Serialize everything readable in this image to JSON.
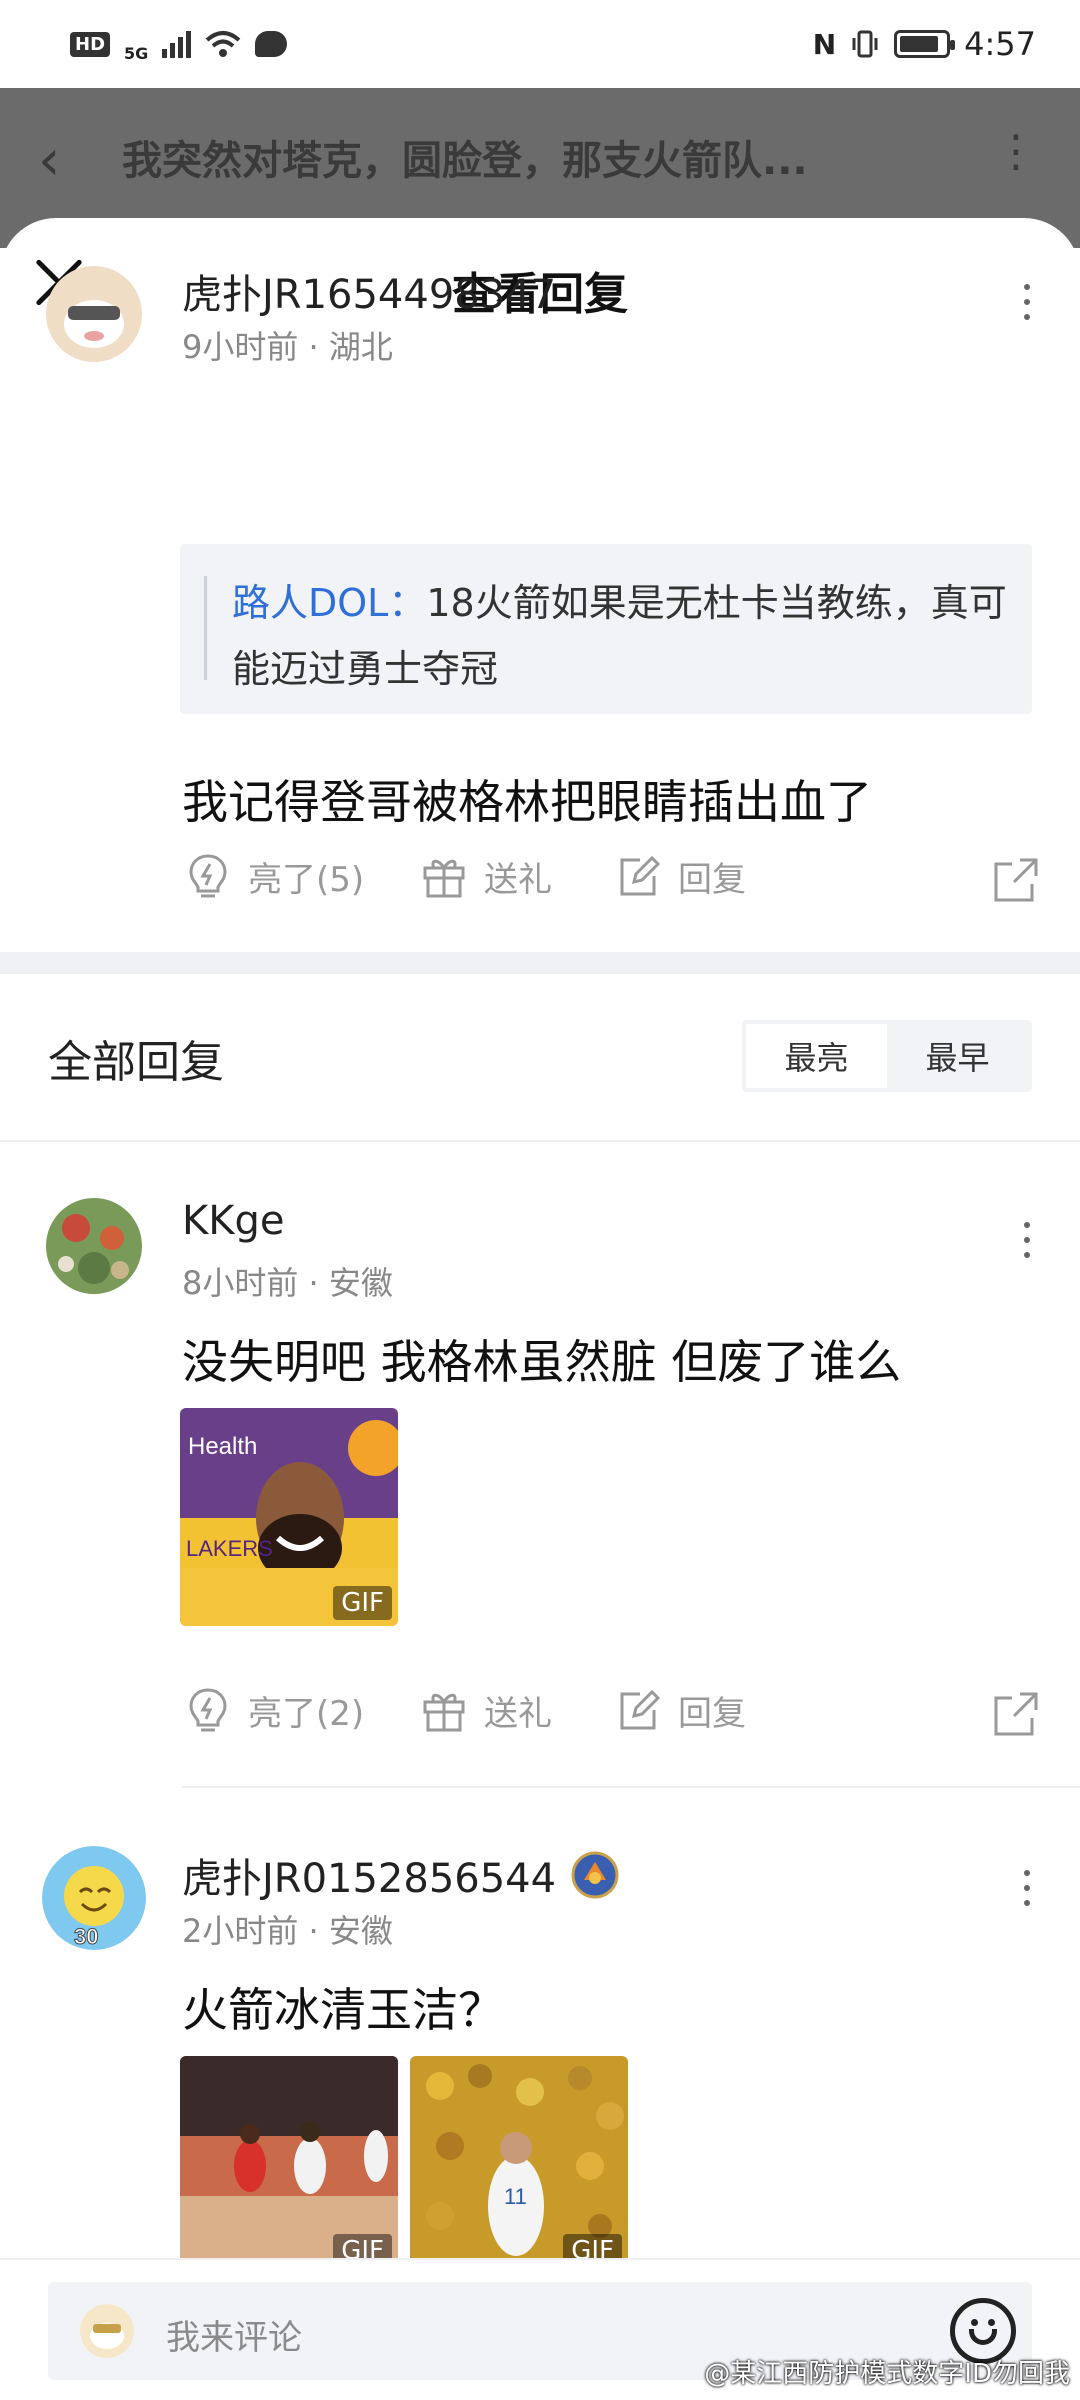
{
  "status_bar": {
    "hd": "HD",
    "signal_label": "5G",
    "time": "4:57",
    "battery_level": 0.85
  },
  "article_header": {
    "back_icon": "chevron-left-icon",
    "title": "我突然对塔克，圆脸登，那支火箭队...",
    "more_icon": "more-vertical-icon"
  },
  "sheet": {
    "title": "查看回复",
    "close_icon": "close-icon"
  },
  "main_comment": {
    "username": "虎扑JR1654498347",
    "meta": "9小时前 · 湖北",
    "quote_author": "路人DOL：",
    "quote_text": "18火箭如果是无杜卡当教练，真可能迈过勇士夺冠",
    "text": "我记得登哥被格林把眼睛插出血了",
    "actions": {
      "like": "亮了(5)",
      "gift": "送礼",
      "reply": "回复"
    }
  },
  "replies_section": {
    "heading": "全部回复",
    "sort_options": [
      "最亮",
      "最早"
    ],
    "active_sort": "最早"
  },
  "replies": [
    {
      "username": "KKge",
      "meta": "8小时前 · 安徽",
      "text": "没失明吧 我格林虽然脏 但废了谁么",
      "gif_badge": "GIF",
      "gif_texts": [
        "Health",
        "LAKERS"
      ],
      "actions": {
        "like": "亮了(2)",
        "gift": "送礼",
        "reply": "回复"
      }
    },
    {
      "username": "虎扑JR0152856544",
      "meta": "2小时前 · 安徽",
      "avatar_badge": "30",
      "text": "火箭冰清玉洁？",
      "gif_badges": [
        "GIF",
        "GIF"
      ],
      "jersey_number": "11"
    }
  ],
  "bottom_bar": {
    "placeholder": "我来评论",
    "emoji_icon": "emoji-icon"
  },
  "watermark": "@某江西防护模式数字ID勿回我",
  "colors": {
    "link_blue": "#2e6fd8",
    "meta_gray": "#888888",
    "separator": "#eef0f4"
  }
}
